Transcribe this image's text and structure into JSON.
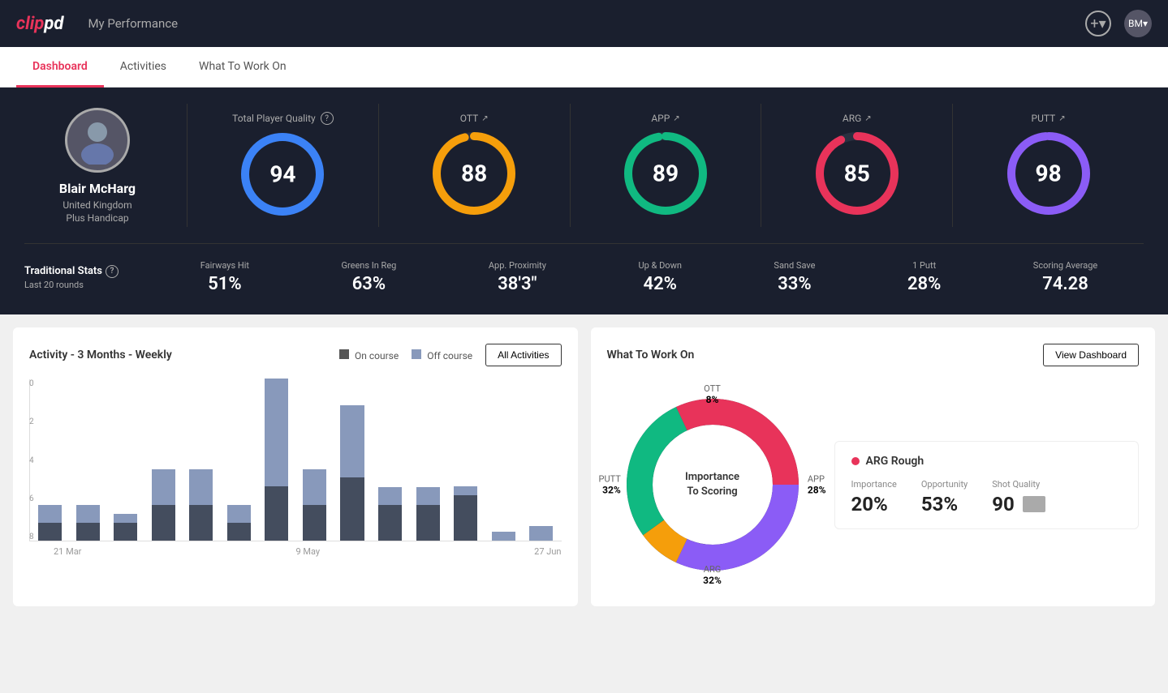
{
  "header": {
    "logo": "clippd",
    "title": "My Performance",
    "add_icon": "+",
    "avatar_initials": "BM"
  },
  "tabs": [
    {
      "id": "dashboard",
      "label": "Dashboard",
      "active": true
    },
    {
      "id": "activities",
      "label": "Activities",
      "active": false
    },
    {
      "id": "what-to-work-on",
      "label": "What To Work On",
      "active": false
    }
  ],
  "player": {
    "name": "Blair McHarg",
    "country": "United Kingdom",
    "handicap": "Plus Handicap"
  },
  "scores": {
    "total": {
      "label": "Total Player Quality",
      "value": "94",
      "color": "#3b82f6",
      "pct": 94
    },
    "ott": {
      "label": "OTT",
      "value": "88",
      "color": "#f59e0b",
      "pct": 88
    },
    "app": {
      "label": "APP",
      "value": "89",
      "color": "#10b981",
      "pct": 89
    },
    "arg": {
      "label": "ARG",
      "value": "85",
      "color": "#e8335a",
      "pct": 85
    },
    "putt": {
      "label": "PUTT",
      "value": "98",
      "color": "#8b5cf6",
      "pct": 98
    }
  },
  "traditional_stats": {
    "title": "Traditional Stats",
    "subtitle": "Last 20 rounds",
    "items": [
      {
        "label": "Fairways Hit",
        "value": "51%"
      },
      {
        "label": "Greens In Reg",
        "value": "63%"
      },
      {
        "label": "App. Proximity",
        "value": "38'3\""
      },
      {
        "label": "Up & Down",
        "value": "42%"
      },
      {
        "label": "Sand Save",
        "value": "33%"
      },
      {
        "label": "1 Putt",
        "value": "28%"
      },
      {
        "label": "Scoring Average",
        "value": "74.28"
      }
    ]
  },
  "activity_chart": {
    "title": "Activity - 3 Months - Weekly",
    "legend": {
      "on_course": "On course",
      "off_course": "Off course"
    },
    "button": "All Activities",
    "x_labels": [
      "21 Mar",
      "9 May",
      "27 Jun"
    ],
    "y_labels": [
      "0",
      "2",
      "4",
      "6",
      "8"
    ],
    "bars": [
      {
        "on": 1,
        "off": 1
      },
      {
        "on": 1,
        "off": 1
      },
      {
        "on": 1,
        "off": 0.5
      },
      {
        "on": 2,
        "off": 2
      },
      {
        "on": 2,
        "off": 2
      },
      {
        "on": 1,
        "off": 1
      },
      {
        "on": 3,
        "off": 6
      },
      {
        "on": 2,
        "off": 2
      },
      {
        "on": 3.5,
        "off": 4
      },
      {
        "on": 2,
        "off": 1
      },
      {
        "on": 2,
        "off": 1
      },
      {
        "on": 2.5,
        "off": 0.5
      },
      {
        "on": 0,
        "off": 0.5
      },
      {
        "on": 0,
        "off": 0.8
      }
    ]
  },
  "work_on": {
    "title": "What To Work On",
    "button": "View Dashboard",
    "donut_center": "Importance\nTo Scoring",
    "segments": [
      {
        "label": "OTT",
        "pct": "8%",
        "color": "#f59e0b"
      },
      {
        "label": "APP",
        "pct": "28%",
        "color": "#10b981"
      },
      {
        "label": "ARG",
        "pct": "32%",
        "color": "#e8335a"
      },
      {
        "label": "PUTT",
        "pct": "32%",
        "color": "#8b5cf6"
      }
    ],
    "card": {
      "title": "ARG Rough",
      "dot_color": "#e8335a",
      "stats": [
        {
          "label": "Importance",
          "value": "20%"
        },
        {
          "label": "Opportunity",
          "value": "53%"
        },
        {
          "label": "Shot Quality",
          "value": "90"
        }
      ]
    }
  }
}
